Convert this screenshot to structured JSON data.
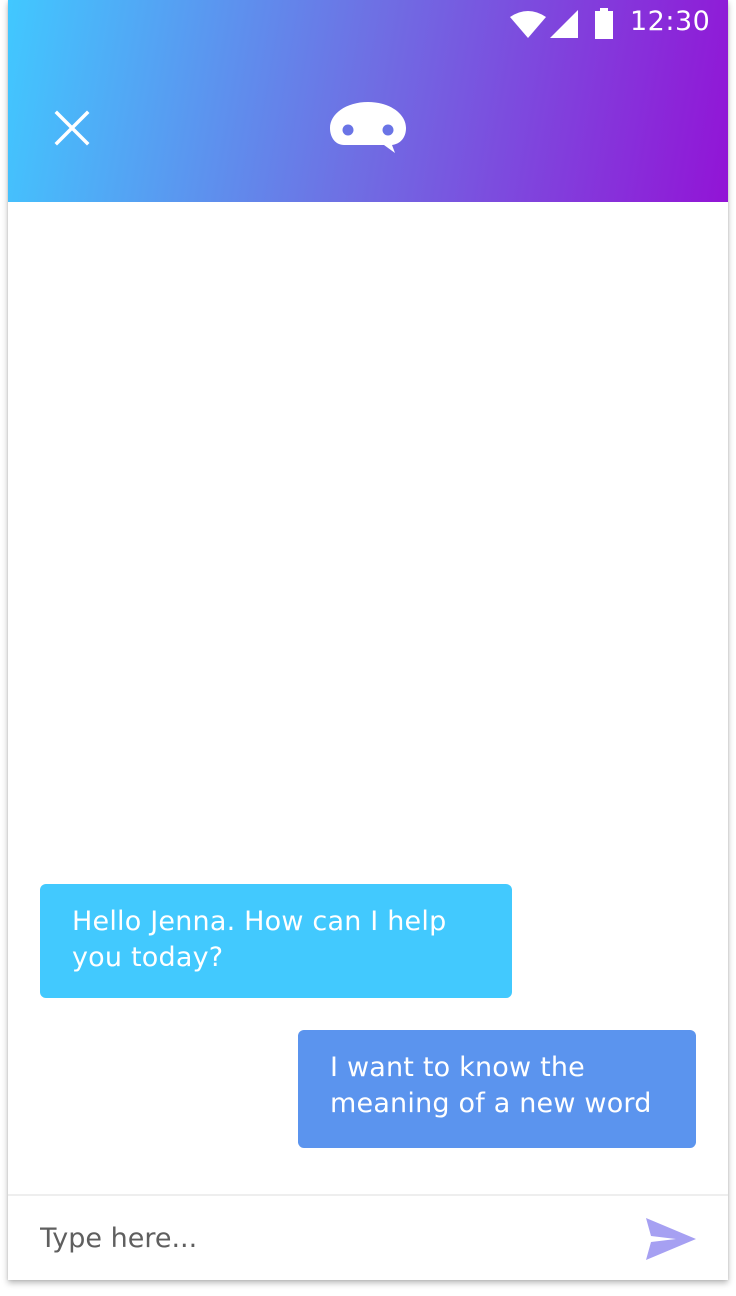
{
  "status_bar": {
    "time": "12:30",
    "icons": [
      "wifi-icon",
      "cell-signal-icon",
      "battery-icon"
    ]
  },
  "header": {
    "close_icon": "close-icon",
    "logo_icon": "chat-bot-icon"
  },
  "chat": {
    "messages": [
      {
        "sender": "bot",
        "text": "Hello Jenna. How can I help you today?"
      },
      {
        "sender": "user",
        "text": "I want to know the meaning of a new word"
      }
    ]
  },
  "composer": {
    "placeholder": "Type here...",
    "value": "",
    "send_icon": "send-icon"
  },
  "colors": {
    "header_gradient_start": "#41c8ff",
    "header_gradient_end": "#9214d6",
    "bot_bubble": "#42c9fe",
    "user_bubble": "#5b94ee",
    "send_icon": "#a6a0f2"
  }
}
